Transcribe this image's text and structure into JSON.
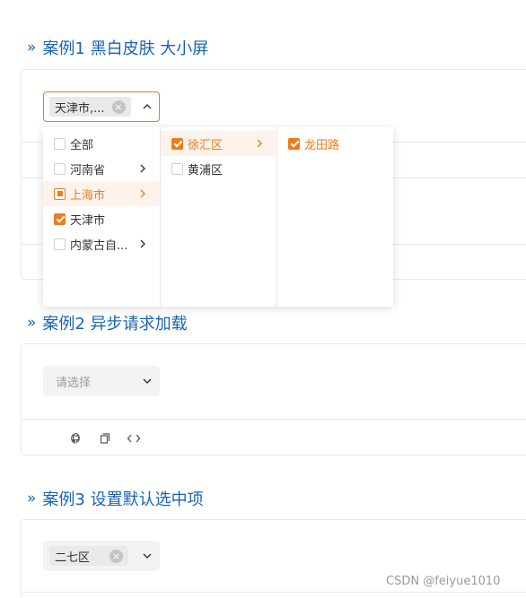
{
  "examples": [
    {
      "title": "案例1 黑白皮肤 大小屏"
    },
    {
      "title": "案例2 异步请求加载"
    },
    {
      "title": "案例3 设置默认选中项"
    }
  ],
  "example1": {
    "tag": "天津市,...",
    "dropdown": {
      "column1": [
        {
          "label": "全部",
          "state": "unchecked",
          "has_children": false
        },
        {
          "label": "河南省",
          "state": "unchecked",
          "has_children": true
        },
        {
          "label": "上海市",
          "state": "indeterminate",
          "has_children": true
        },
        {
          "label": "天津市",
          "state": "checked",
          "has_children": false
        },
        {
          "label": "内蒙古自...",
          "state": "unchecked",
          "has_children": true
        }
      ],
      "column2": [
        {
          "label": "徐汇区",
          "state": "checked",
          "has_children": true
        },
        {
          "label": "黄浦区",
          "state": "unchecked",
          "has_children": false
        }
      ],
      "column3": [
        {
          "label": "龙田路",
          "state": "checked",
          "has_children": false
        }
      ]
    }
  },
  "example2": {
    "placeholder": "请选择"
  },
  "example3": {
    "tag": "二七区"
  },
  "toolbar": {
    "icons": [
      "github-icon",
      "copy-icon",
      "code-icon"
    ]
  },
  "watermark": "CSDN @feiyue1010",
  "colors": {
    "accent": "#f07b1b",
    "heading": "#1664b8",
    "border": "#e8e8e8"
  }
}
